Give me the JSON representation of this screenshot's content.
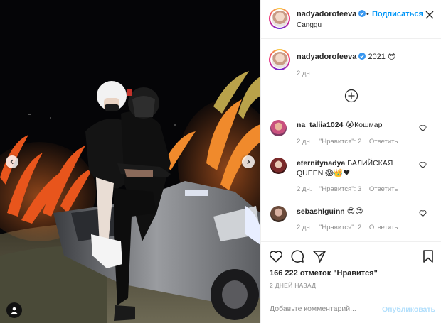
{
  "post": {
    "author": "nadyadorofeeva",
    "follow_separator": "•",
    "follow_label": "Подписаться",
    "location": "Canggu",
    "caption_text": "2021",
    "caption_emoji": "😎",
    "caption_time": "2 дн."
  },
  "comments": [
    {
      "username": "na_taliia1024",
      "emoji": "😭",
      "text": "Кошмар",
      "time": "2 дн.",
      "likes": "\"Нравится\": 2",
      "reply": "Ответить"
    },
    {
      "username": "eternitynadya",
      "text": "БАЛИЙСКАЯ QUEEN",
      "emoji": "😱👑♥",
      "time": "2 дн.",
      "likes": "\"Нравится\": 3",
      "reply": "Ответить"
    },
    {
      "username": "sebashlguinn",
      "emoji": "😍😍",
      "time": "2 дн.",
      "likes": "\"Нравится\": 2",
      "reply": "Ответить"
    }
  ],
  "footer": {
    "likes_count": "166 222 отметок \"Нравится\"",
    "posted_ago": "2 ДНЕЙ НАЗАД",
    "comment_placeholder": "Добавьте комментарий...",
    "publish_label": "Опубликовать"
  },
  "colors": {
    "accent": "#0095f6",
    "publish_disabled": "#b2dffc",
    "muted": "#8e8e8e"
  },
  "icons": {
    "verified": "verified-badge-icon",
    "more": "more-options-icon",
    "load_more": "plus-circle-icon",
    "like": "heart-icon",
    "comment": "comment-bubble-icon",
    "share": "paper-plane-icon",
    "save": "bookmark-icon",
    "tag": "user-tag-icon"
  }
}
